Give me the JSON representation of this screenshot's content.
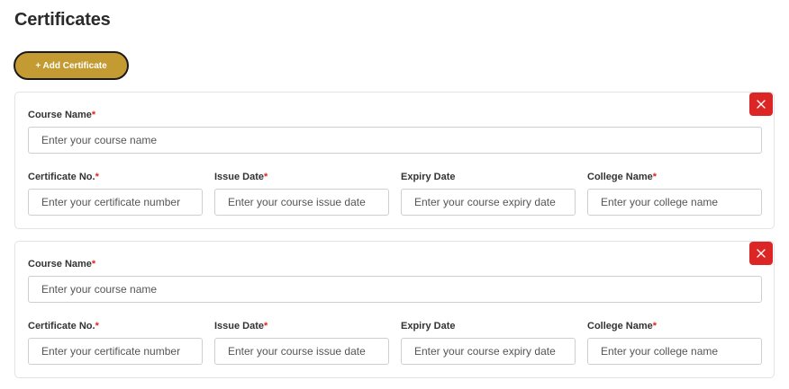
{
  "page": {
    "title": "Certificates",
    "add_button_label": "+ Add Certificate"
  },
  "icons": {
    "remove": "close-icon"
  },
  "colors": {
    "accent": "#c49a32",
    "danger": "#dc2626",
    "required": "#dc2626"
  },
  "certificates": [
    {
      "course_name": {
        "label": "Course Name",
        "required": "*",
        "value": "",
        "placeholder": "Enter your course name"
      },
      "certificate_no": {
        "label": "Certificate No.",
        "required": "*",
        "value": "",
        "placeholder": "Enter your certificate number"
      },
      "issue_date": {
        "label": "Issue Date",
        "required": "*",
        "value": "",
        "placeholder": "Enter your course issue date"
      },
      "expiry_date": {
        "label": "Expiry Date",
        "value": "",
        "placeholder": "Enter your course expiry date"
      },
      "college_name": {
        "label": "College Name",
        "required": "*",
        "value": "",
        "placeholder": "Enter your college name"
      }
    },
    {
      "course_name": {
        "label": "Course Name",
        "required": "*",
        "value": "",
        "placeholder": "Enter your course name"
      },
      "certificate_no": {
        "label": "Certificate No.",
        "required": "*",
        "value": "",
        "placeholder": "Enter your certificate number"
      },
      "issue_date": {
        "label": "Issue Date",
        "required": "*",
        "value": "",
        "placeholder": "Enter your course issue date"
      },
      "expiry_date": {
        "label": "Expiry Date",
        "value": "",
        "placeholder": "Enter your course expiry date"
      },
      "college_name": {
        "label": "College Name",
        "required": "*",
        "value": "",
        "placeholder": "Enter your college name"
      }
    }
  ]
}
